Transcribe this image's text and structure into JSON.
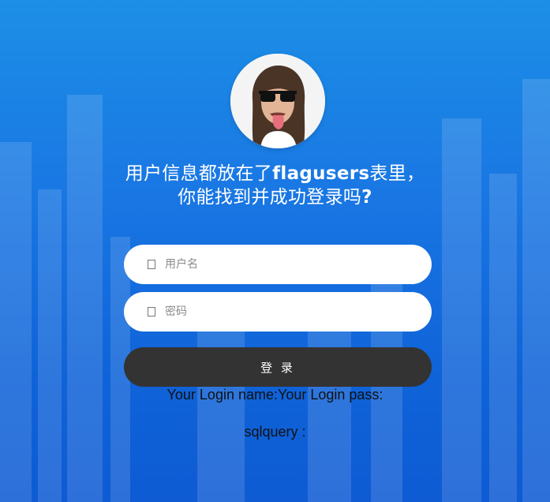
{
  "headline": {
    "line1_prefix": "用户信息都放在了",
    "line1_bold": "flagusers",
    "line1_suffix": "表里，",
    "line2_prefix": "你能找到并成功登录吗",
    "line2_bold": "?"
  },
  "form": {
    "username_placeholder": "用户名",
    "password_placeholder": "密码",
    "username_icon": "user-icon",
    "password_icon": "lock-icon",
    "login_label": "登 录"
  },
  "result": {
    "credentials_text": "Your Login name:Your Login pass:",
    "sqlquery_text": "sqlquery :"
  },
  "colors": {
    "background_top": "#1c8fe6",
    "background_bottom": "#0e5bd4",
    "button": "#333333",
    "input": "#ffffff"
  }
}
